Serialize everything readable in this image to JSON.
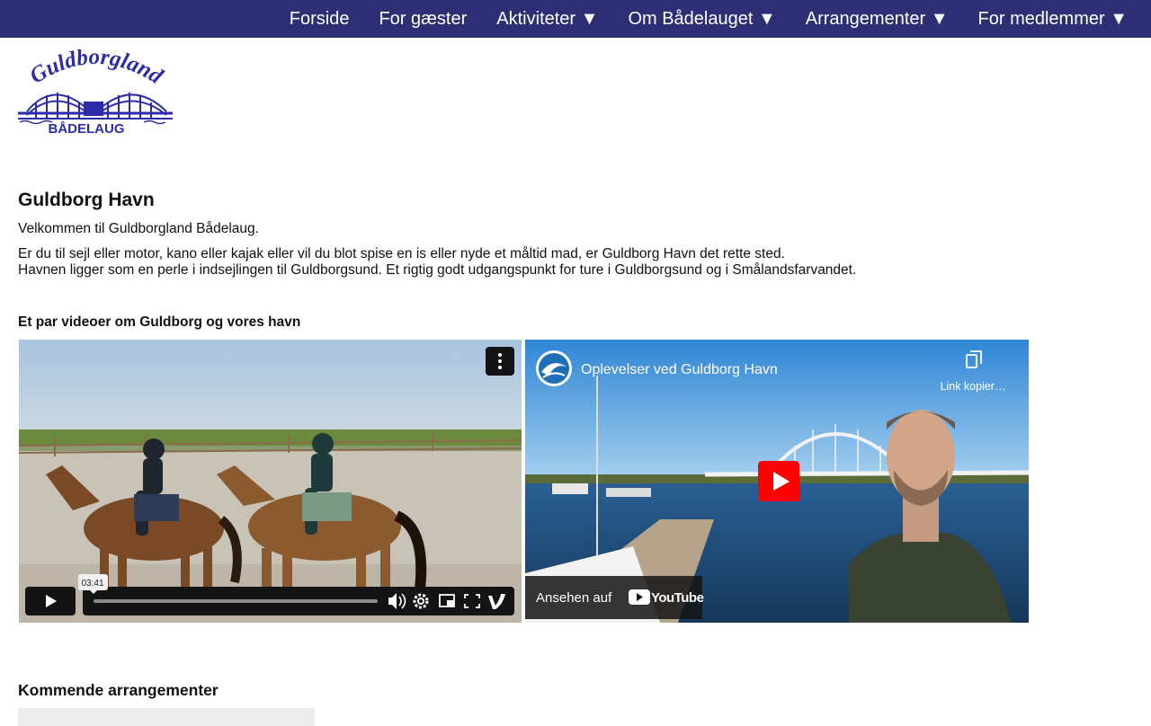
{
  "nav": {
    "items": [
      {
        "label": "Forside"
      },
      {
        "label": "For gæster"
      },
      {
        "label": "Aktiviteter ▼"
      },
      {
        "label": "Om Bådelauget ▼"
      },
      {
        "label": "Arrangementer ▼"
      },
      {
        "label": "For medlemmer ▼"
      }
    ]
  },
  "logo": {
    "text_top": "Guldborgland",
    "text_bottom": "BÅDELAUG"
  },
  "main": {
    "title": "Guldborg Havn",
    "welcome": "Velkommen til Guldborgland Bådelaug.",
    "intro_line1": "Er du til sejl eller motor, kano eller kajak eller vil du blot spise en is eller nyde et måltid mad, er Guldborg Havn det rette sted.",
    "intro_line2": "Havnen ligger som en perle i indsejlingen til Guldborgsund. Et rigtig godt udgangspunkt for ture i Guldborgsund og i Smålandsfarvandet."
  },
  "videos": {
    "heading": "Et par videoer om Guldborg og vores havn",
    "vimeo": {
      "time_tooltip": "03:41"
    },
    "youtube": {
      "title": "Oplevelser ved Guldborg Havn",
      "copy_link_label": "Link kopier…",
      "watch_on_label": "Ansehen auf",
      "brand_label": "YouTube"
    }
  },
  "events": {
    "heading": "Kommende arrangementer"
  },
  "colors": {
    "nav_bg": "#2e2e75",
    "logo_blue": "#2c2ca8",
    "youtube_red": "#ff0000"
  }
}
